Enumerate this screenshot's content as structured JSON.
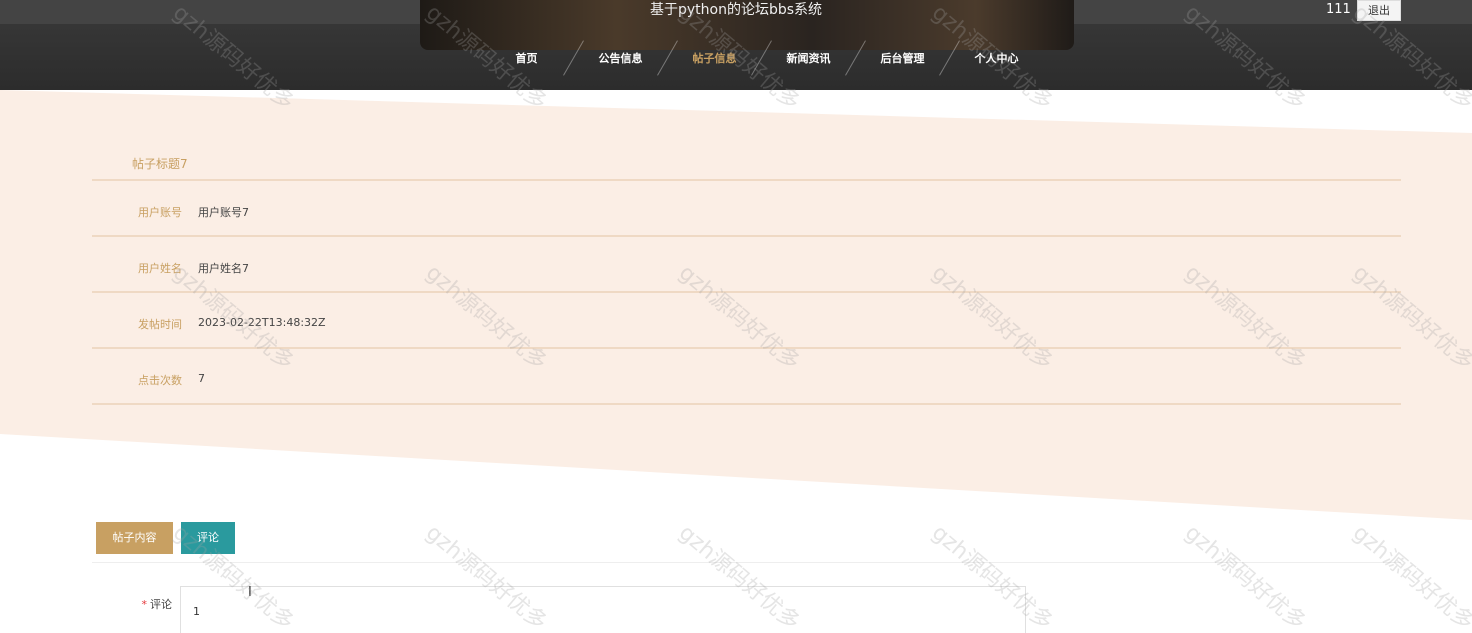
{
  "header": {
    "site_title": "基于python的论坛bbs系统",
    "user_name": "111",
    "logout_label": "退出",
    "nav": [
      {
        "label": "首页",
        "active": false
      },
      {
        "label": "公告信息",
        "active": false
      },
      {
        "label": "帖子信息",
        "active": true
      },
      {
        "label": "新闻资讯",
        "active": false
      },
      {
        "label": "后台管理",
        "active": false
      },
      {
        "label": "个人中心",
        "active": false
      }
    ]
  },
  "detail": {
    "title": "帖子标题7",
    "rows": [
      {
        "label": "用户账号",
        "value": "用户账号7"
      },
      {
        "label": "用户姓名",
        "value": "用户姓名7"
      },
      {
        "label": "发帖时间",
        "value": "2023-02-22T13:48:32Z"
      },
      {
        "label": "点击次数",
        "value": "7"
      }
    ]
  },
  "tabs": {
    "content_label": "帖子内容",
    "comment_label": "评论"
  },
  "comment_form": {
    "required_mark": "*",
    "label": "评论",
    "value": "1"
  },
  "watermark": "gzh源码好优多",
  "colors": {
    "accent": "#c8a062",
    "teal": "#2a9a9e",
    "band": "#fbeee5",
    "header": "#333333"
  }
}
